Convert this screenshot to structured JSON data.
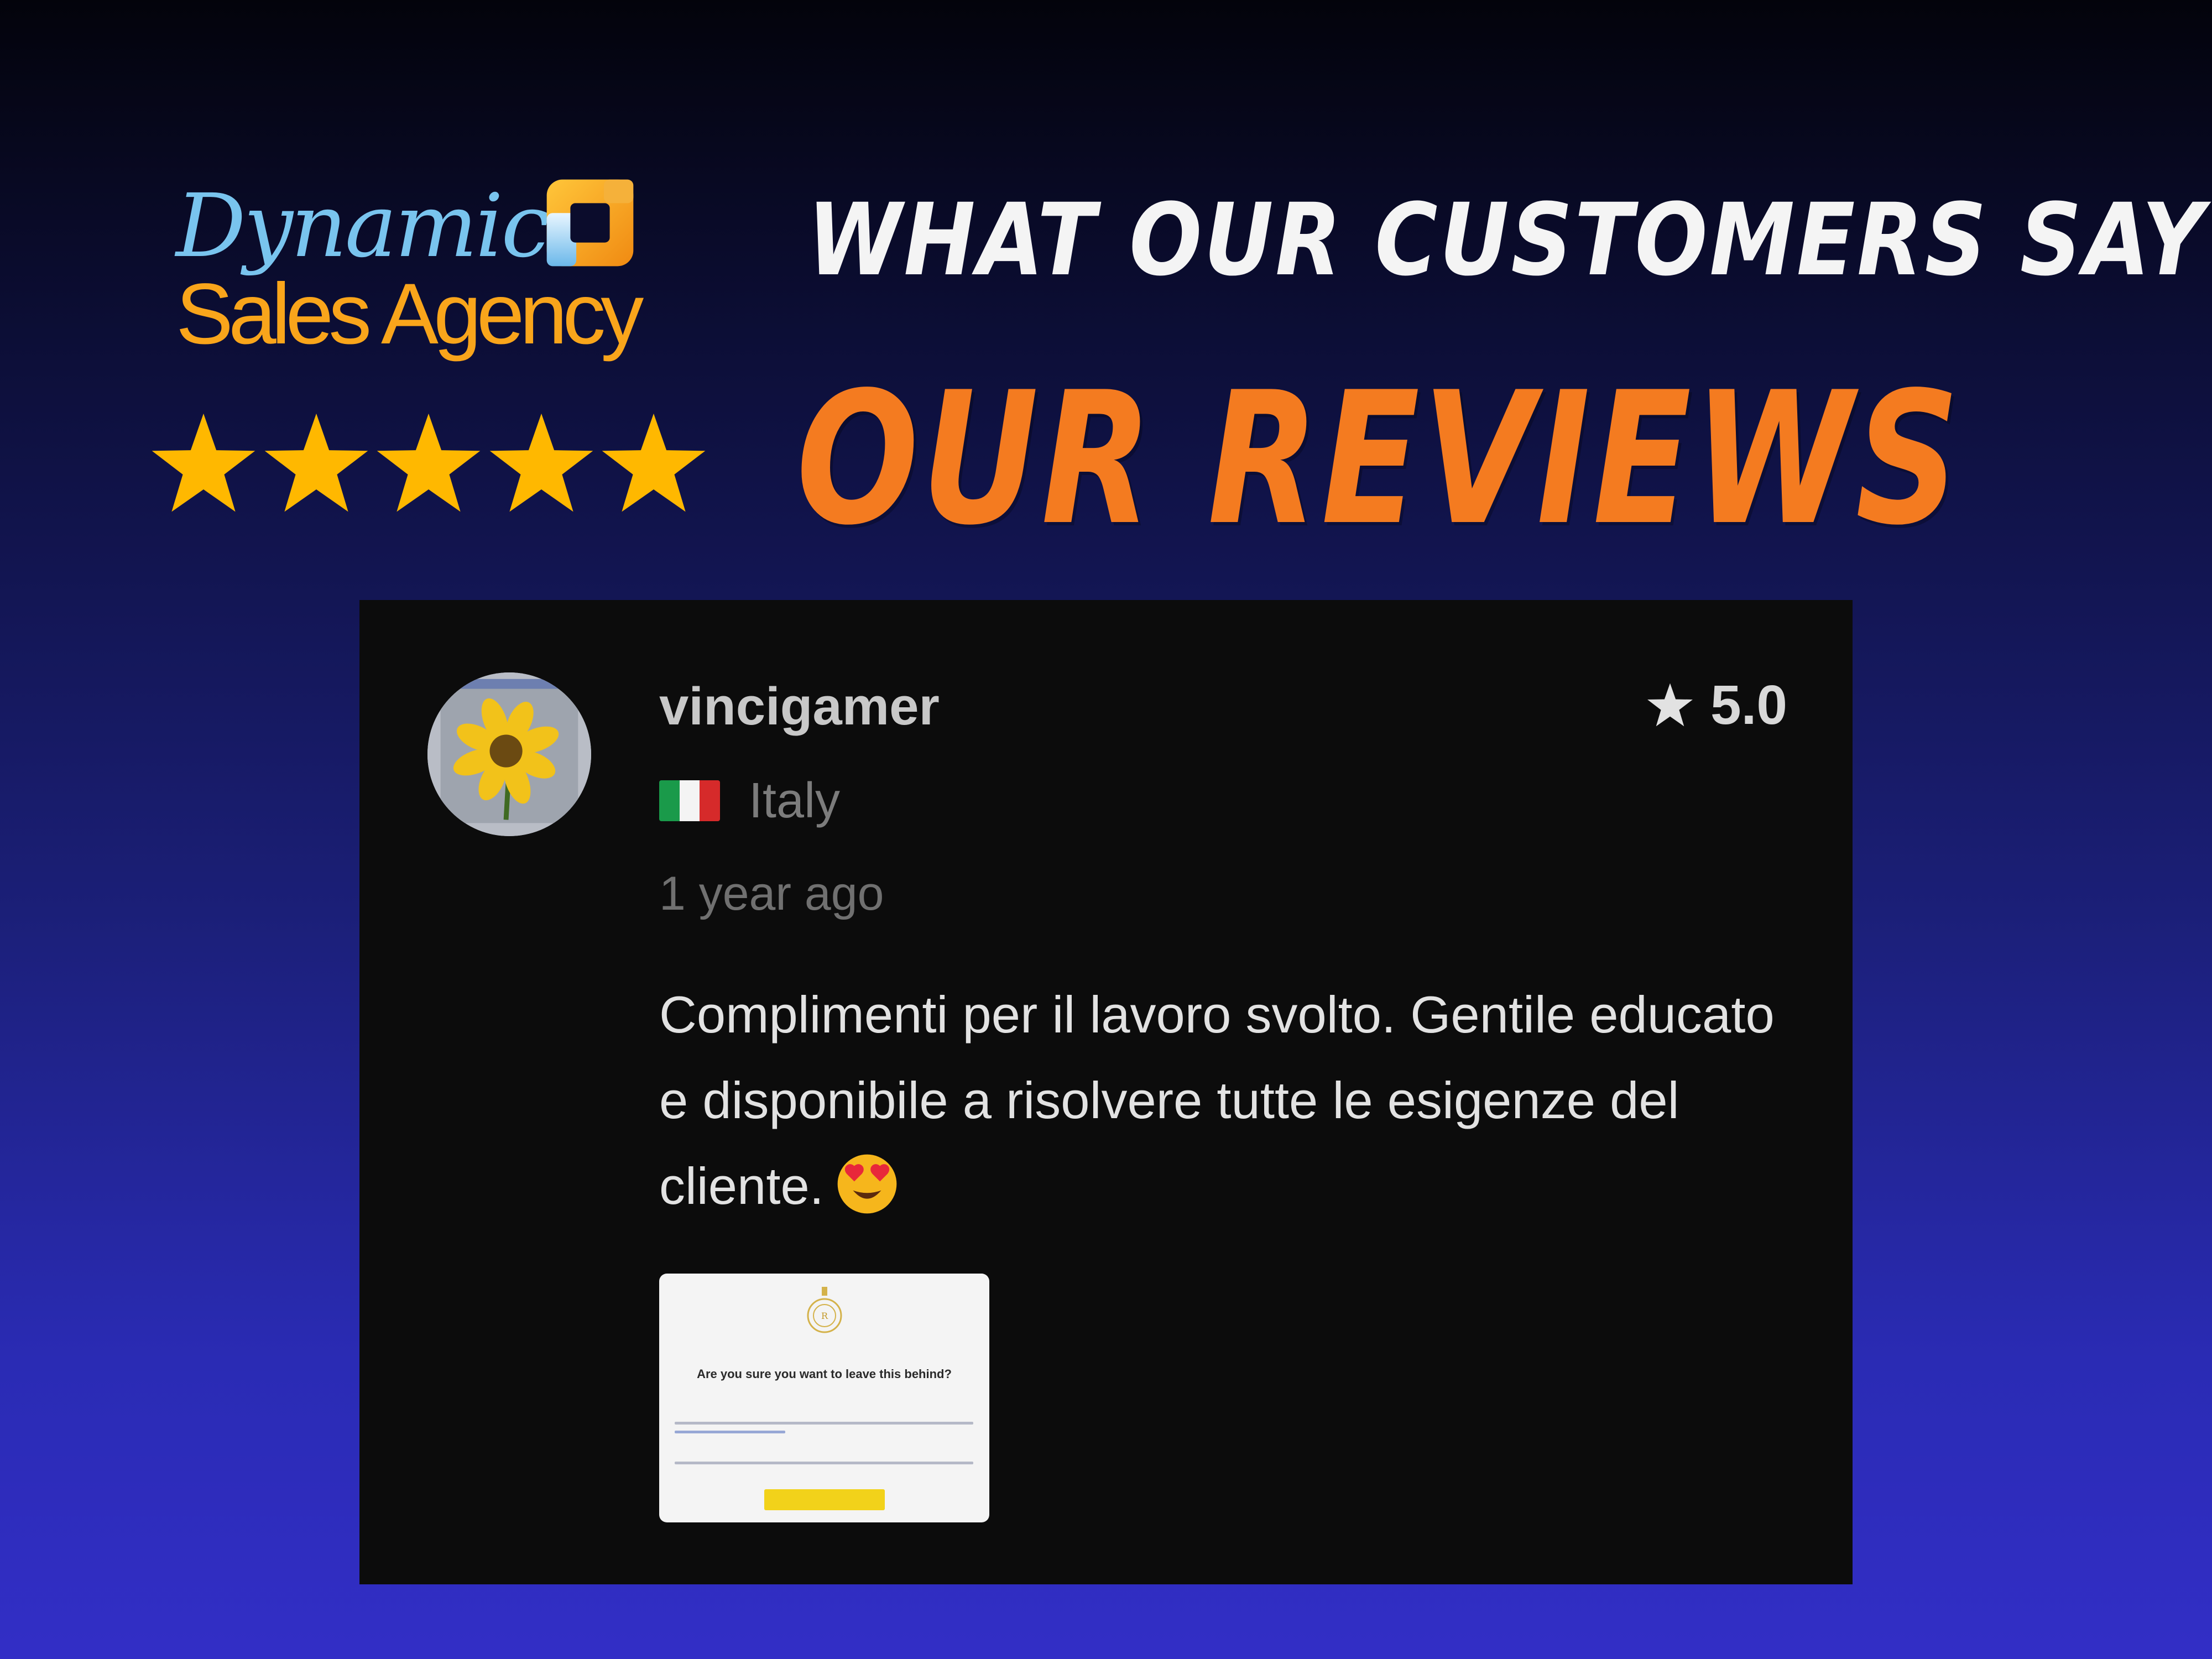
{
  "brand": {
    "logo_line1": "Dynamic",
    "logo_line2": "Sales Agency",
    "logo_icon": "square-ring-logo-icon",
    "colors": {
      "primary_blue": "#79c4ee",
      "primary_orange": "#f9a51b"
    }
  },
  "rating_stars": {
    "icon": "star-icon",
    "count": 5,
    "color": "#ffb800"
  },
  "header": {
    "tagline": "What our customers say",
    "title": "Our Reviews",
    "title_color": "#f47b20"
  },
  "review": {
    "username": "vincigamer",
    "rating_icon": "star-icon",
    "rating": "5.0",
    "country": "Italy",
    "country_flag": "italy-flag-icon",
    "time_ago": "1 year ago",
    "text": "Complimenti per il lavoro svolto. Gentile educato e disponibile a risolvere tutte le esigenze del cliente.",
    "emoji": "heart-eyes-emoji-icon",
    "attachment": {
      "title": "Are you sure you want to leave this behind?"
    }
  }
}
